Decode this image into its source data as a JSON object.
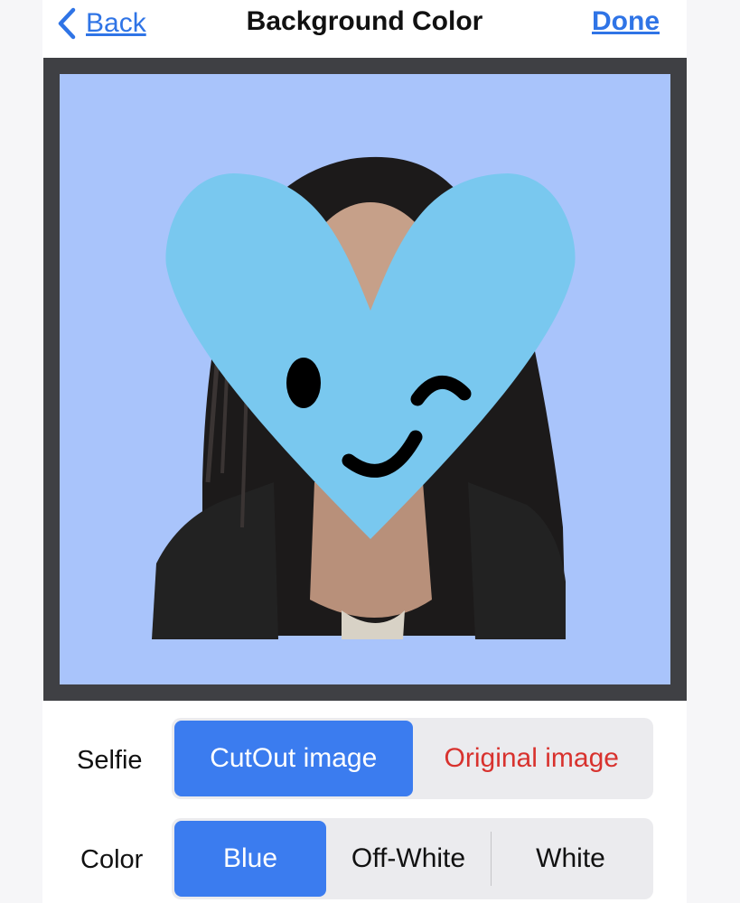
{
  "navbar": {
    "back_label": "Back",
    "title": "Background Color",
    "done_label": "Done"
  },
  "photo": {
    "background_color": "#a9c4fb",
    "frame_color": "#3f4044",
    "sticker": "heart-face-sticker"
  },
  "selfie": {
    "label": "Selfie",
    "options": [
      "CutOut image",
      "Original image"
    ],
    "selected": "CutOut image"
  },
  "color": {
    "label": "Color",
    "options": [
      "Blue",
      "Off-White",
      "White"
    ],
    "selected": "Blue"
  },
  "colors": {
    "accent": "#3b7cef",
    "link": "#2f74e6",
    "warning_text": "#d8322e"
  }
}
